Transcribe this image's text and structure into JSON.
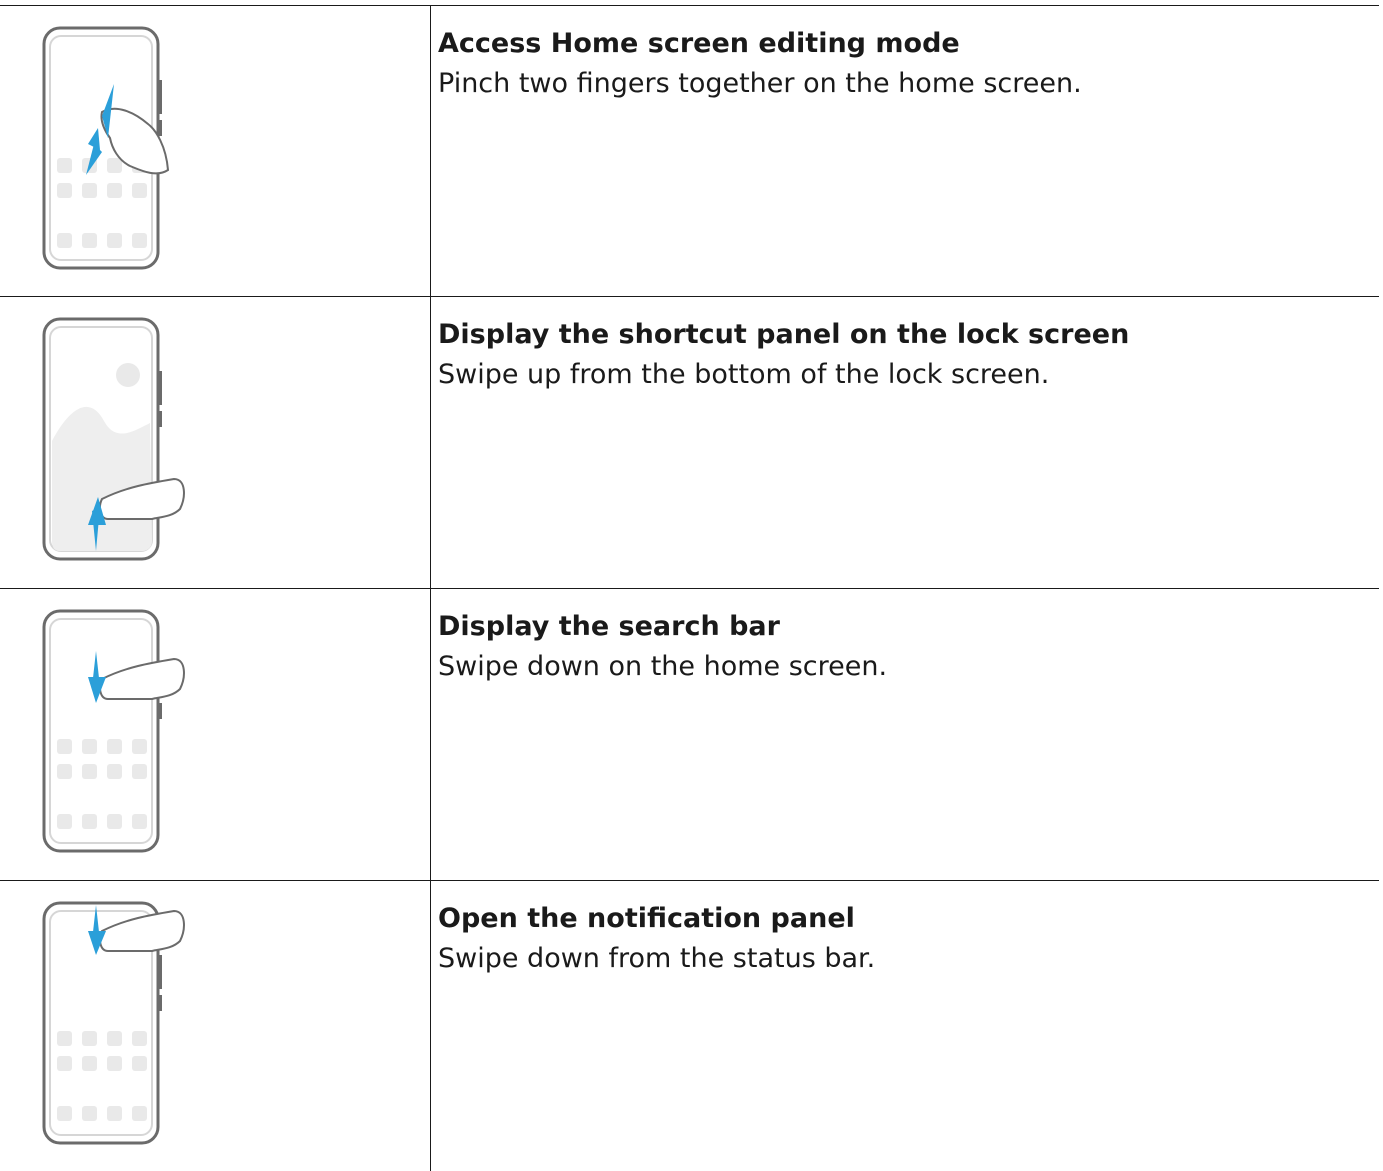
{
  "accent_color": "#2b9fd9",
  "phone_frame_color": "#6b6b6b",
  "rows": [
    {
      "title": "Access Home screen editing mode",
      "description": "Pinch two fingers together on the home screen.",
      "illustration": "pinch-gesture-icon"
    },
    {
      "title": "Display the shortcut panel on the lock screen",
      "description": "Swipe up from the bottom of the lock screen.",
      "illustration": "swipe-up-gesture-icon"
    },
    {
      "title": "Display the search bar",
      "description": "Swipe down on the home screen.",
      "illustration": "swipe-down-middle-gesture-icon"
    },
    {
      "title": "Open the notification panel",
      "description": "Swipe down from the status bar.",
      "illustration": "swipe-down-top-gesture-icon"
    }
  ]
}
